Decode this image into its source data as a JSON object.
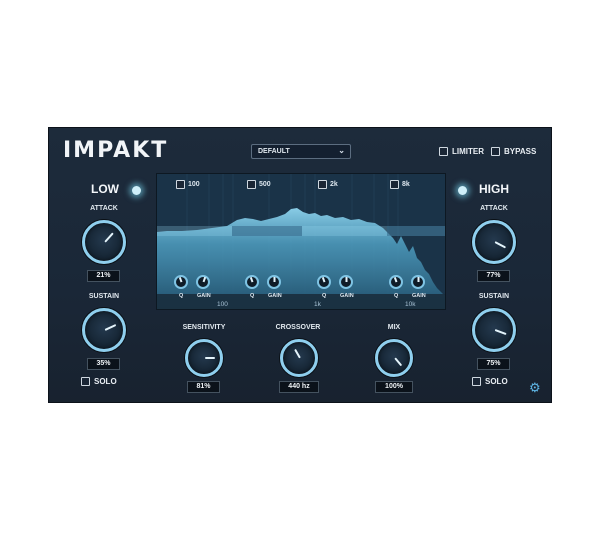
{
  "app": {
    "title": "IMPAKT"
  },
  "preset": {
    "value": "DEFAULT"
  },
  "toggles": {
    "limiter": "LIMITER",
    "bypass": "BYPASS"
  },
  "low": {
    "title": "LOW",
    "attack": {
      "label": "ATTACK",
      "value": "21%"
    },
    "sustain": {
      "label": "SUSTAIN",
      "value": "35%"
    },
    "solo": "SOLO"
  },
  "high": {
    "title": "HIGH",
    "attack": {
      "label": "ATTACK",
      "value": "77%"
    },
    "sustain": {
      "label": "SUSTAIN",
      "value": "75%"
    },
    "solo": "SOLO"
  },
  "eq": {
    "bands": [
      {
        "label": "100",
        "q": "Q",
        "gain": "GAIN"
      },
      {
        "label": "500",
        "q": "Q",
        "gain": "GAIN"
      },
      {
        "label": "2k",
        "q": "Q",
        "gain": "GAIN"
      },
      {
        "label": "8k",
        "q": "Q",
        "gain": "GAIN"
      }
    ],
    "freq_labels": [
      "100",
      "1k",
      "10k"
    ]
  },
  "main": {
    "sensitivity": {
      "label": "SENSITIVITY",
      "value": "81%"
    },
    "crossover": {
      "label": "CROSSOVER",
      "value": "440 hz"
    },
    "mix": {
      "label": "MIX",
      "value": "100%"
    }
  },
  "colors": {
    "accent": "#8fcfee",
    "panel": "#1c2a3a",
    "spectrum": "#7fcbe6"
  },
  "icons": {
    "settings": "gear-icon",
    "preset_dropdown": "chevron-down-icon"
  }
}
